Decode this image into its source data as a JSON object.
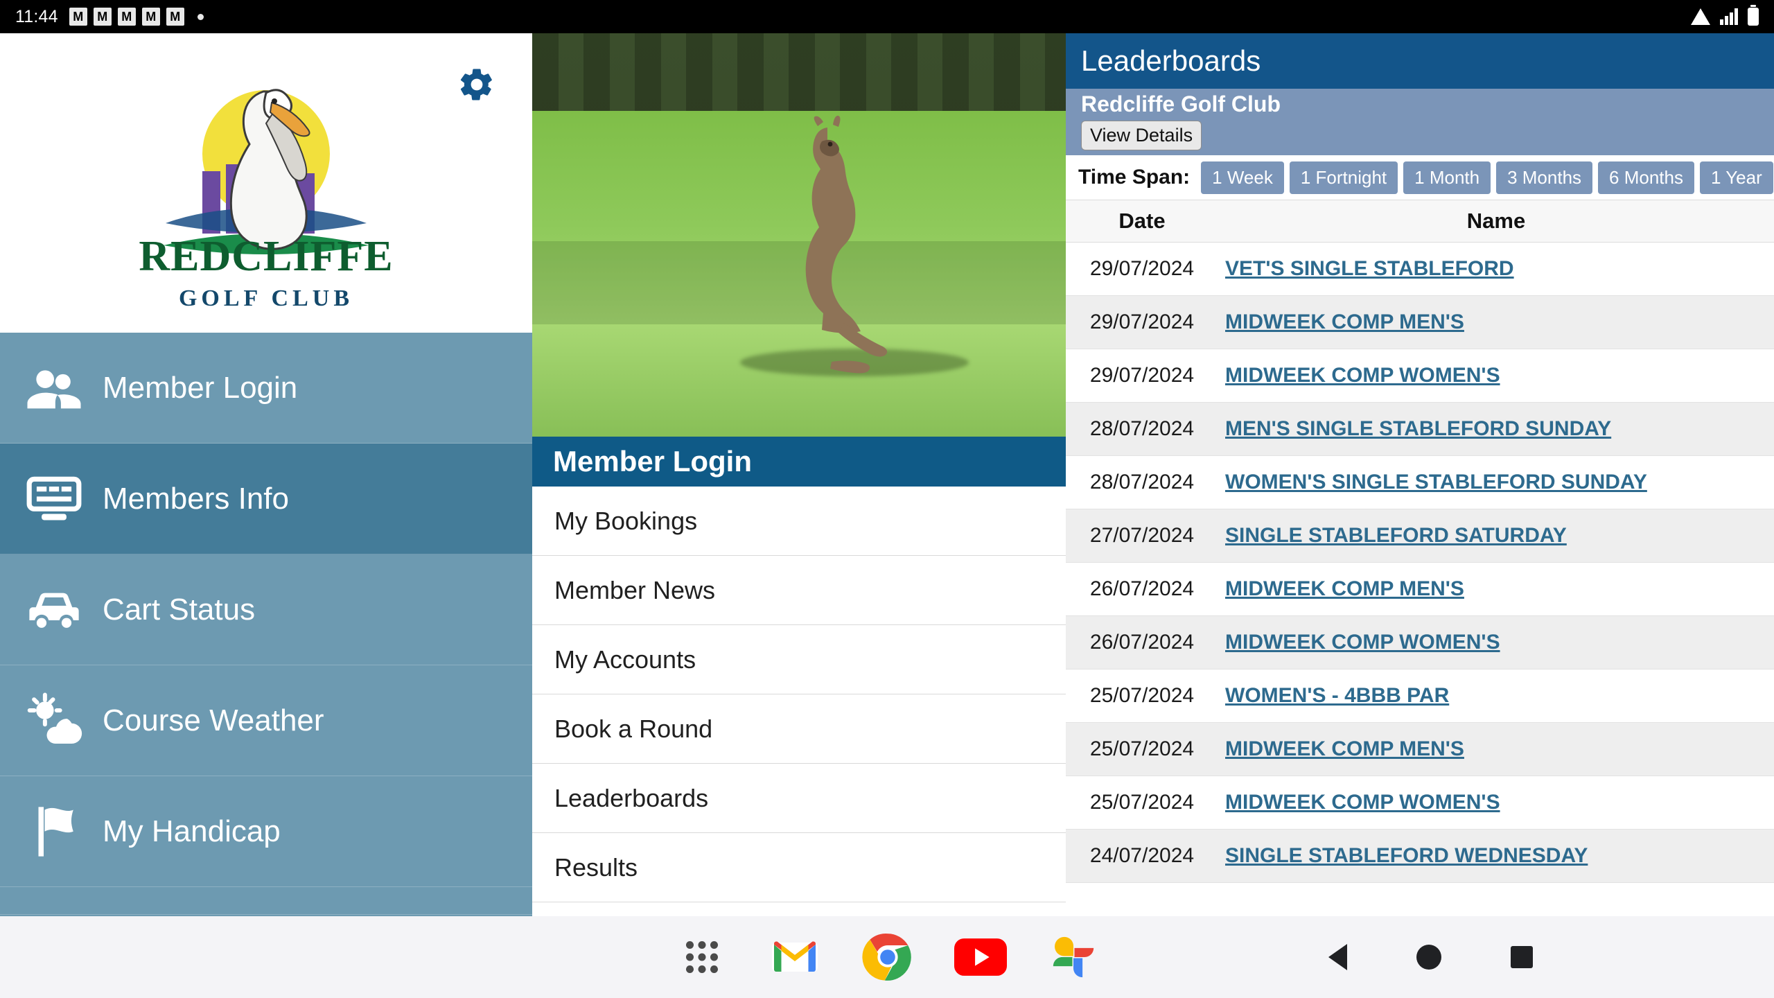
{
  "statusbar": {
    "clock": "11:44",
    "notification_icons": [
      "notif-icon",
      "notif-icon",
      "notif-icon",
      "notif-icon",
      "notif-icon"
    ],
    "dot": "•",
    "right_icons": [
      "wifi-icon",
      "signal-icon",
      "battery-icon"
    ]
  },
  "sidebar": {
    "logo": {
      "title": "REDCLIFFE",
      "subtitle": "GOLF CLUB",
      "alt": "pelican-logo"
    },
    "settings_icon": "gear-icon",
    "items": [
      {
        "label": "Member Login",
        "icon": "members-icon",
        "selected": false
      },
      {
        "label": "Members Info",
        "icon": "info-screen-icon",
        "selected": true
      },
      {
        "label": "Cart Status",
        "icon": "cart-icon",
        "selected": false
      },
      {
        "label": "Course Weather",
        "icon": "weather-icon",
        "selected": false
      },
      {
        "label": "My Handicap",
        "icon": "flag-icon",
        "selected": false
      }
    ]
  },
  "middle": {
    "hero_alt": "kangaroo-on-fairway-photo",
    "header": "Member Login",
    "items": [
      "My Bookings",
      "Member News",
      "My Accounts",
      "Book a Round",
      "Leaderboards",
      "Results"
    ]
  },
  "leaderboards": {
    "title": "Leaderboards",
    "club": "Redcliffe Golf Club",
    "view_details": "View Details",
    "timespan_label": "Time Span:",
    "timespans": [
      "1 Week",
      "1 Fortnight",
      "1 Month",
      "3 Months",
      "6 Months",
      "1 Year"
    ],
    "columns": [
      "Date",
      "Name"
    ],
    "rows": [
      {
        "date": "29/07/2024",
        "name": "VET'S SINGLE STABLEFORD"
      },
      {
        "date": "29/07/2024",
        "name": "MIDWEEK COMP MEN'S"
      },
      {
        "date": "29/07/2024",
        "name": "MIDWEEK COMP WOMEN'S"
      },
      {
        "date": "28/07/2024",
        "name": "MEN'S SINGLE STABLEFORD SUNDAY"
      },
      {
        "date": "28/07/2024",
        "name": "WOMEN'S SINGLE STABLEFORD SUNDAY"
      },
      {
        "date": "27/07/2024",
        "name": "SINGLE STABLEFORD SATURDAY"
      },
      {
        "date": "26/07/2024",
        "name": "MIDWEEK COMP MEN'S"
      },
      {
        "date": "26/07/2024",
        "name": "MIDWEEK COMP WOMEN'S"
      },
      {
        "date": "25/07/2024",
        "name": "WOMEN'S - 4BBB PAR"
      },
      {
        "date": "25/07/2024",
        "name": "MIDWEEK COMP MEN'S"
      },
      {
        "date": "25/07/2024",
        "name": "MIDWEEK COMP WOMEN'S"
      },
      {
        "date": "24/07/2024",
        "name": "SINGLE STABLEFORD WEDNESDAY"
      }
    ]
  },
  "navbar": {
    "apps": [
      "app-drawer-icon",
      "gmail-icon",
      "chrome-icon",
      "youtube-icon",
      "google-photos-icon"
    ],
    "system": [
      "back-button",
      "home-button",
      "recents-button"
    ]
  },
  "colors": {
    "sidebar": "#6d9ab1",
    "sidebar_selected": "#447c99",
    "header_blue": "#13558a",
    "mid_header_blue": "#0f5a87",
    "club_band": "#7b95b8",
    "link": "#2d6a8e"
  }
}
